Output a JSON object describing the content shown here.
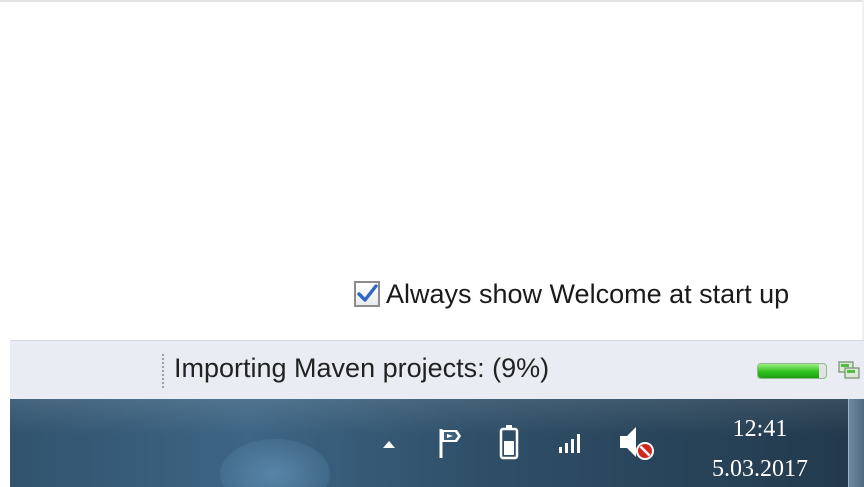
{
  "welcome": {
    "checked": true,
    "label": "Always show Welcome at start up"
  },
  "status_bar": {
    "message": "Importing Maven projects: (9%)",
    "progress_fraction": 0.9,
    "progress_color": "#2fc21e",
    "progress_view_icon": "progress-view-icon"
  },
  "taskbar": {
    "tray_icons": [
      "show-hidden-icons-icon",
      "action-center-flag-icon",
      "battery-icon",
      "network-signal-icon",
      "speaker-muted-icon"
    ],
    "clock": {
      "time": "12:41",
      "date": "5.03.2017"
    }
  }
}
